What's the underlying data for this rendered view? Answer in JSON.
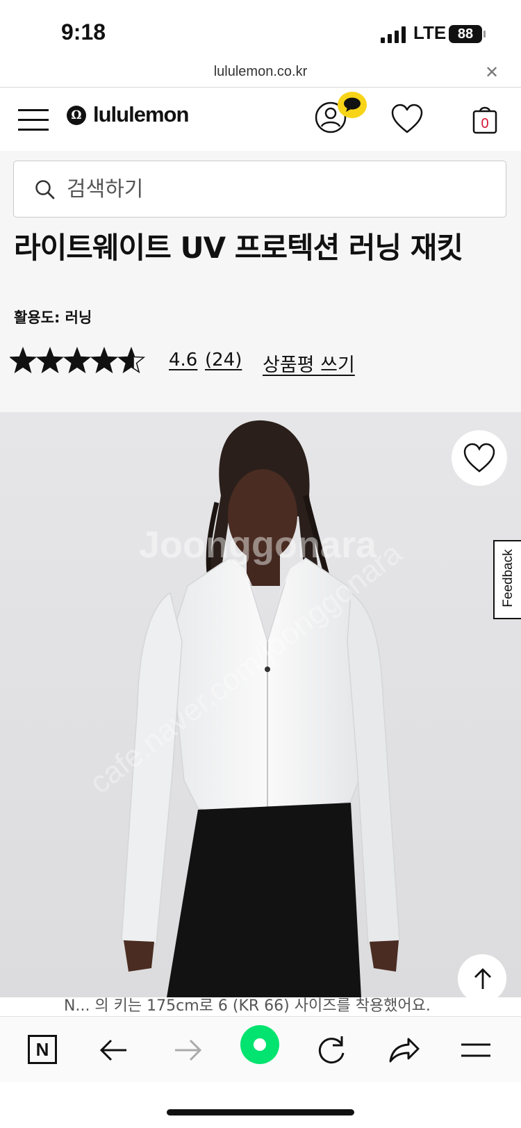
{
  "status_bar": {
    "time": "9:18",
    "network": "LTE",
    "battery": "88"
  },
  "browser": {
    "url": "lululemon.co.kr",
    "close_icon": "close-icon"
  },
  "header": {
    "brand": "lululemon",
    "logo_mark": "Ω",
    "cart_count": "0",
    "icons": [
      "menu-icon",
      "account-icon",
      "chat-icon",
      "heart-icon",
      "shopping-bag-icon"
    ]
  },
  "search": {
    "placeholder": "검색하기"
  },
  "product": {
    "title": "라이트웨이트 UV 프로텍션 러닝 재킷",
    "activity": "활용도: 러닝",
    "rating": {
      "value": "4.6",
      "count": "(24)",
      "stars": 4.6,
      "max_stars": 5
    },
    "write_review": "상품평 쓰기"
  },
  "image": {
    "watermark_brand": "Joonggonara",
    "watermark_url": "cafe.naver.com/joonggonara",
    "caption": "N... 의 키는 175cm로 6 (KR 66) 사이즈를 착용했어요."
  },
  "feedback": {
    "label": "Feedback"
  },
  "bottom_nav": {
    "logo": "N",
    "icons": [
      "naver-logo-icon",
      "back-arrow-icon",
      "forward-arrow-icon",
      "green-dot-icon",
      "refresh-icon",
      "share-icon",
      "menu-icon"
    ]
  },
  "colors": {
    "accent_red": "#d31334",
    "kakao_yellow": "#f8d418",
    "naver_green": "#03e36f",
    "image_bg": "#e3e3e5"
  }
}
